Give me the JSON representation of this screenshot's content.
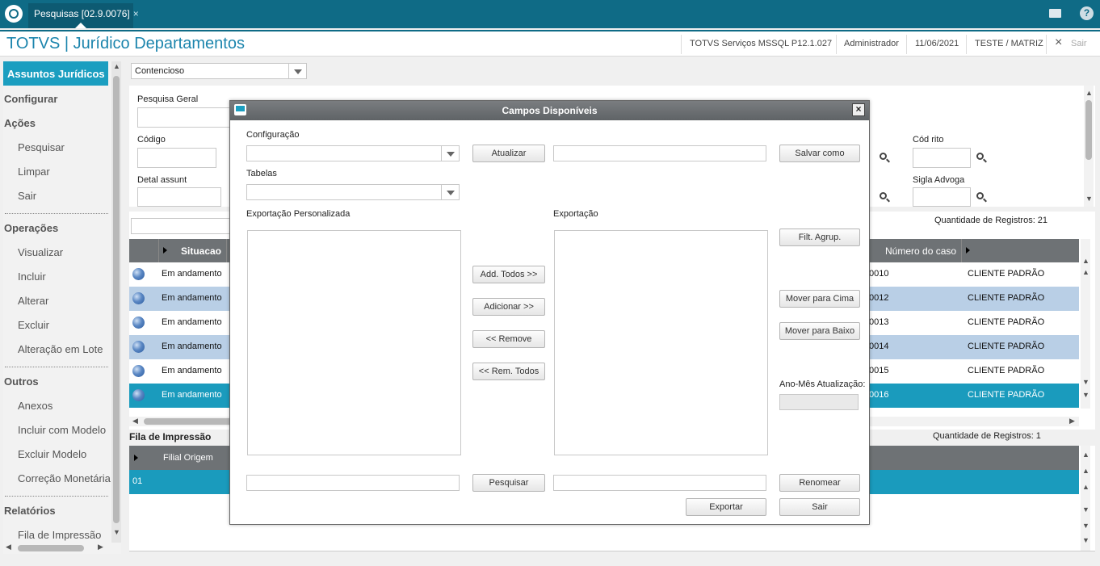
{
  "topbar": {
    "tab_label": "Pesquisas [02.9.0076]",
    "tab_close": "×"
  },
  "header": {
    "title": "TOTVS | Jurídico Departamentos",
    "service": "TOTVS Serviços MSSQL P12.1.027",
    "user": "Administrador",
    "date": "11/06/2021",
    "company": "TESTE / MATRIZ",
    "exit_icon": "×",
    "exit": "Sair"
  },
  "sidebar": {
    "active": "Assuntos Jurídicos",
    "configurar": "Configurar",
    "acoes": "Ações",
    "acoes_items": [
      "Pesquisar",
      "Limpar",
      "Sair"
    ],
    "operacoes": "Operações",
    "operacoes_items": [
      "Visualizar",
      "Incluir",
      "Alterar",
      "Excluir",
      "Alteração em Lote"
    ],
    "outros": "Outros",
    "outros_items": [
      "Anexos",
      "Incluir com Modelo",
      "Excluir Modelo",
      "Correção Monetária"
    ],
    "relatorios": "Relatórios",
    "relatorios_items": [
      "Fila de Impressão"
    ]
  },
  "main": {
    "combo_value": "Contencioso",
    "search_labels": {
      "geral": "Pesquisa Geral",
      "codigo": "Código",
      "detal": "Detal assunt",
      "cod_rito": "Cód rito",
      "sigla": "Sigla Advoga"
    },
    "records_label": "Quantidade de Registros: 21",
    "grid_cols": {
      "situacao": "Situacao",
      "numero": "Número do caso"
    },
    "rows": [
      {
        "situacao": "Em andamento",
        "num": "0010",
        "cliente": "CLIENTE PADRÃO"
      },
      {
        "situacao": "Em andamento",
        "num": "0012",
        "cliente": "CLIENTE PADRÃO"
      },
      {
        "situacao": "Em andamento",
        "num": "0013",
        "cliente": "CLIENTE PADRÃO"
      },
      {
        "situacao": "Em andamento",
        "num": "0014",
        "cliente": "CLIENTE PADRÃO"
      },
      {
        "situacao": "Em andamento",
        "num": "0015",
        "cliente": "CLIENTE PADRÃO"
      },
      {
        "situacao": "Em andamento",
        "num": "0016",
        "cliente": "CLIENTE PADRÃO"
      }
    ],
    "print_queue_title": "Fila de Impressão",
    "print_records": "Quantidade de Registros: 1",
    "print_col": "Filial Origem",
    "print_row": "01"
  },
  "dialog": {
    "title": "Campos Disponíveis",
    "close": "×",
    "config_label": "Configuração",
    "tables_label": "Tabelas",
    "atualizar": "Atualizar",
    "salvar_como": "Salvar como",
    "export_custom_label": "Exportação Personalizada",
    "export_label": "Exportação",
    "filt_agrup": "Filt. Agrup.",
    "add_todos": "Add. Todos >>",
    "adicionar": "Adicionar >>",
    "remove": "<< Remove",
    "rem_todos": "<< Rem. Todos",
    "mover_cima": "Mover para Cima",
    "mover_baixo": "Mover para Baixo",
    "ano_mes": "Ano-Mês Atualização:",
    "pesquisar": "Pesquisar",
    "renomear": "Renomear",
    "exportar": "Exportar",
    "sair": "Sair"
  },
  "colors": {
    "topbar": "#0f6b86",
    "accent": "#1b9ec0",
    "title": "#1c85ad",
    "row_alt": "#b9cfe6"
  }
}
